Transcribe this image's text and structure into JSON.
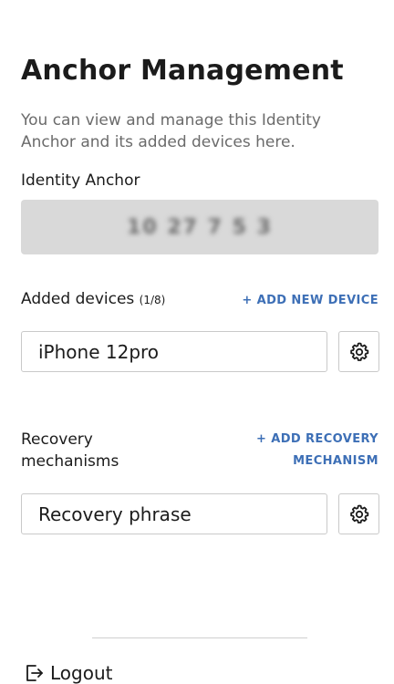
{
  "header": {
    "title": "Anchor Management",
    "subtitle": "You can view and manage this Identity Anchor and its added devices here."
  },
  "identity_anchor": {
    "label": "Identity Anchor",
    "number": "10 27 7 5 3"
  },
  "devices": {
    "label": "Added devices",
    "count": "(1/8)",
    "add_label": "+ ADD NEW DEVICE",
    "items": [
      {
        "name": "iPhone 12pro",
        "settings_icon": "gear-icon"
      }
    ]
  },
  "recovery": {
    "label_line1": "Recovery",
    "label_line2": "mechanisms",
    "add_label_line1": "+ ADD RECOVERY",
    "add_label_line2": "MECHANISM",
    "items": [
      {
        "name": "Recovery phrase",
        "settings_icon": "gear-icon"
      }
    ]
  },
  "footer": {
    "logout_label": "Logout",
    "logout_icon": "logout-icon"
  },
  "colors": {
    "link": "#3d6fb6",
    "anchor_bg": "#d9d9d9",
    "subtitle": "#6b6b6b"
  }
}
